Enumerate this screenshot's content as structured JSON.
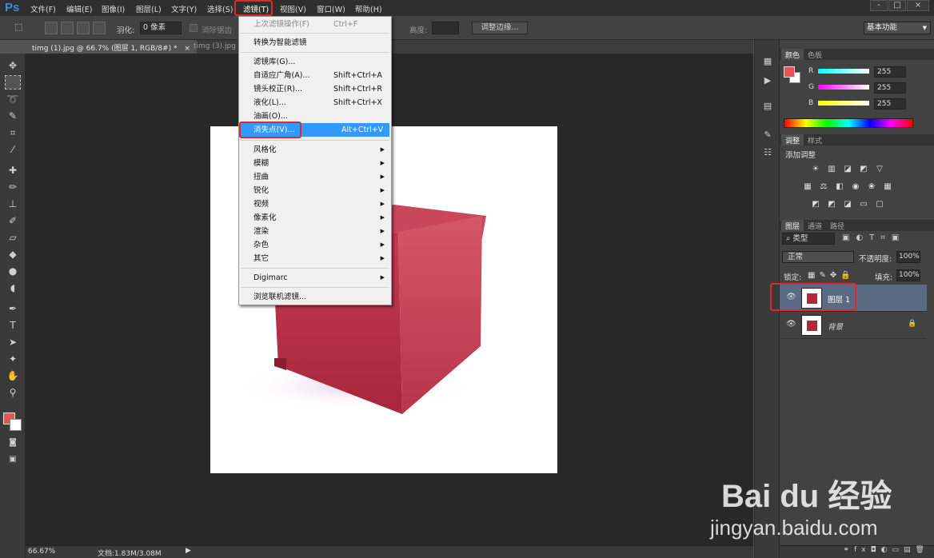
{
  "app": {
    "logo": "Ps"
  },
  "menubar": {
    "items": [
      "文件(F)",
      "编辑(E)",
      "图像(I)",
      "图层(L)",
      "文字(Y)",
      "选择(S)",
      "滤镜(T)",
      "视图(V)",
      "窗口(W)",
      "帮助(H)"
    ],
    "window_controls": [
      "-",
      "□",
      "×"
    ]
  },
  "options": {
    "feather_label": "羽化:",
    "feather_value": "0 像素",
    "antialias_label": "消除锯齿",
    "height_label": "高度:",
    "refine_edge_button": "调整边缘...",
    "workspace_value": "基本功能"
  },
  "tabs": [
    {
      "label": "timg (1).jpg @ 66.7% (图层 1, RGB/8#) *",
      "close": "×",
      "active": true
    },
    {
      "label": "timg (3).jpg",
      "active": false
    }
  ],
  "status": {
    "zoom": "66.67%",
    "doc": "文档:1.83M/3.08M"
  },
  "filter_menu": {
    "items": [
      {
        "label": "上次滤镜操作(F)",
        "shortcut": "Ctrl+F",
        "disabled": true
      },
      {
        "label": "转换为智能滤镜"
      },
      {
        "label": "滤镜库(G)..."
      },
      {
        "label": "自适应广角(A)...",
        "shortcut": "Shift+Ctrl+A"
      },
      {
        "label": "镜头校正(R)...",
        "shortcut": "Shift+Ctrl+R"
      },
      {
        "label": "液化(L)...",
        "shortcut": "Shift+Ctrl+X"
      },
      {
        "label": "油画(O)..."
      },
      {
        "label": "消失点(V)...",
        "shortcut": "Alt+Ctrl+V",
        "highlighted": true
      },
      {
        "label": "风格化",
        "submenu": true
      },
      {
        "label": "模糊",
        "submenu": true
      },
      {
        "label": "扭曲",
        "submenu": true
      },
      {
        "label": "锐化",
        "submenu": true
      },
      {
        "label": "视频",
        "submenu": true
      },
      {
        "label": "像素化",
        "submenu": true
      },
      {
        "label": "渲染",
        "submenu": true
      },
      {
        "label": "杂色",
        "submenu": true
      },
      {
        "label": "其它",
        "submenu": true
      },
      {
        "label": "Digimarc",
        "submenu": true
      },
      {
        "label": "浏览联机滤镜..."
      }
    ]
  },
  "color_panel": {
    "tabs": [
      "颜色",
      "色板"
    ],
    "channels": [
      {
        "name": "R",
        "value": "255"
      },
      {
        "name": "G",
        "value": "255"
      },
      {
        "name": "B",
        "value": "255"
      }
    ],
    "foreground": "#e8535a",
    "background": "#ffffff"
  },
  "adjustments_panel": {
    "tabs": [
      "调整",
      "样式"
    ],
    "title": "添加调整"
  },
  "layers_panel": {
    "tabs": [
      "图层",
      "通道",
      "路径"
    ],
    "filter_kind": "类型",
    "blend_mode": "正常",
    "opacity_label": "不透明度:",
    "opacity_value": "100%",
    "lock_label": "锁定:",
    "fill_label": "填充:",
    "fill_value": "100%",
    "layers": [
      {
        "name": "图层 1",
        "selected": true
      },
      {
        "name": "背景",
        "locked": true
      }
    ]
  },
  "watermark": {
    "brand": "Bai du 经验",
    "url": "jingyan.baidu.com"
  },
  "colors": {
    "highlight": "#3399ff",
    "annotation": "#e02828",
    "box": "#b3273d"
  }
}
